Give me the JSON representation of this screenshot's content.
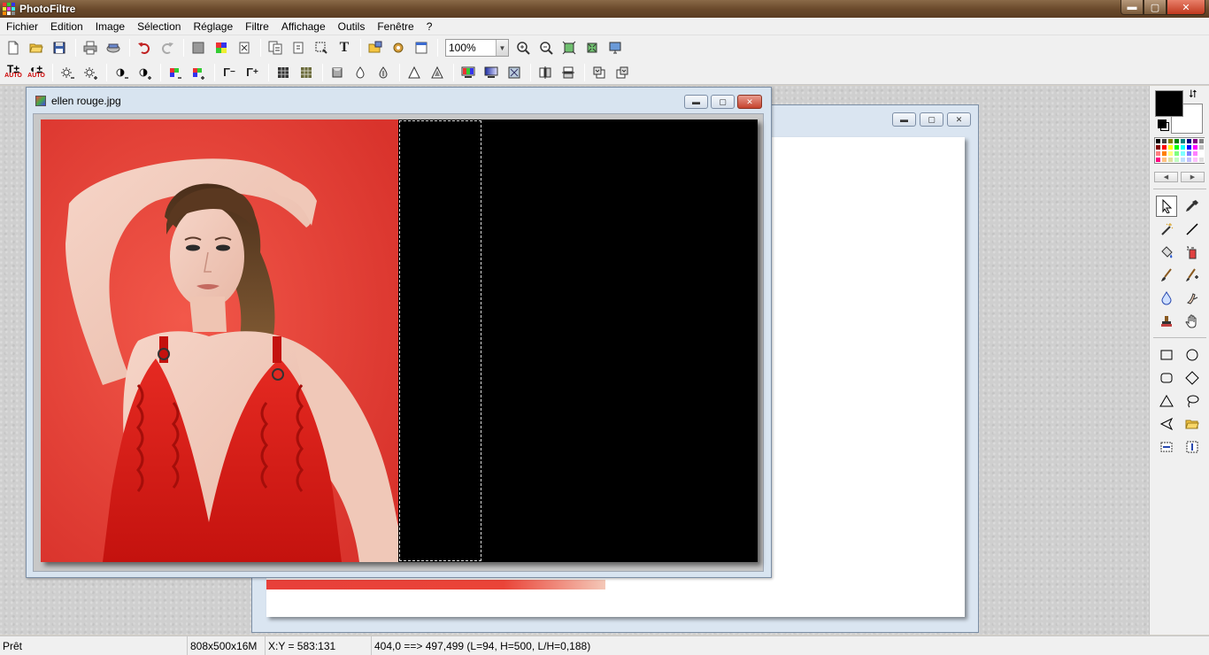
{
  "app": {
    "title": "PhotoFiltre",
    "window_controls": {
      "minimize": "▬",
      "maximize": "▢",
      "close": "✕"
    }
  },
  "menu": [
    "Fichier",
    "Edition",
    "Image",
    "Sélection",
    "Réglage",
    "Filtre",
    "Affichage",
    "Outils",
    "Fenêtre",
    "?"
  ],
  "toolbar": {
    "zoom_value": "100%",
    "auto_label": "AUTO",
    "text_tool_glyph": "T"
  },
  "colors": {
    "foreground": "#000000",
    "background": "#ffffff",
    "palette": [
      "#000000",
      "#404040",
      "#808000",
      "#008000",
      "#008080",
      "#000080",
      "#800080",
      "#808080",
      "#800000",
      "#ff0000",
      "#ffff00",
      "#00ff00",
      "#00ffff",
      "#0000ff",
      "#ff00ff",
      "#c0c0c0",
      "#ff8080",
      "#ff8000",
      "#ffff80",
      "#80ff80",
      "#80ffff",
      "#8080ff",
      "#ff80ff",
      "#ffffff",
      "#ff0080",
      "#ffc080",
      "#e0e0a0",
      "#c0ffc0",
      "#c0e0ff",
      "#c0c0ff",
      "#ffc0ff",
      "#e0e0e0"
    ]
  },
  "documents": {
    "front": {
      "title": "ellen rouge.jpg"
    },
    "back": {
      "title": ""
    }
  },
  "status": {
    "state": "Prêt",
    "image_info": "808x500x16M",
    "cursor": "X:Y = 583:131",
    "selection": "404,0 ==> 497,499 (L=94, H=500, L/H=0,188)"
  }
}
